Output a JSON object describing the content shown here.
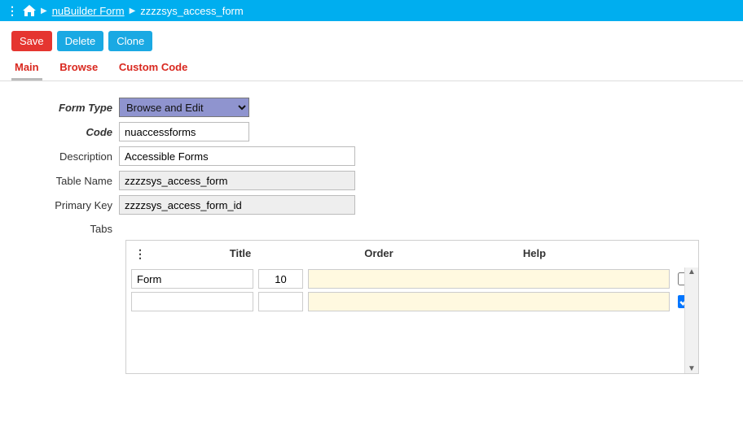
{
  "breadcrumb": {
    "home_title": "Home",
    "link": "nuBuilder Form",
    "current": "zzzzsys_access_form"
  },
  "toolbar": {
    "save": "Save",
    "delete": "Delete",
    "clone": "Clone"
  },
  "tabs": {
    "main": "Main",
    "browse": "Browse",
    "custom": "Custom Code"
  },
  "form": {
    "labels": {
      "form_type": "Form Type",
      "code": "Code",
      "description": "Description",
      "table_name": "Table Name",
      "primary_key": "Primary Key",
      "tabs": "Tabs"
    },
    "values": {
      "form_type_selected": "Browse and Edit",
      "code": "nuaccessforms",
      "description": "Accessible Forms",
      "table_name": "zzzzsys_access_form",
      "primary_key": "zzzzsys_access_form_id"
    }
  },
  "subgrid": {
    "headers": {
      "title": "Title",
      "order": "Order",
      "help": "Help"
    },
    "rows": [
      {
        "title": "Form",
        "order": "10",
        "help": "",
        "checked": false
      },
      {
        "title": "",
        "order": "",
        "help": "",
        "checked": true
      }
    ]
  }
}
